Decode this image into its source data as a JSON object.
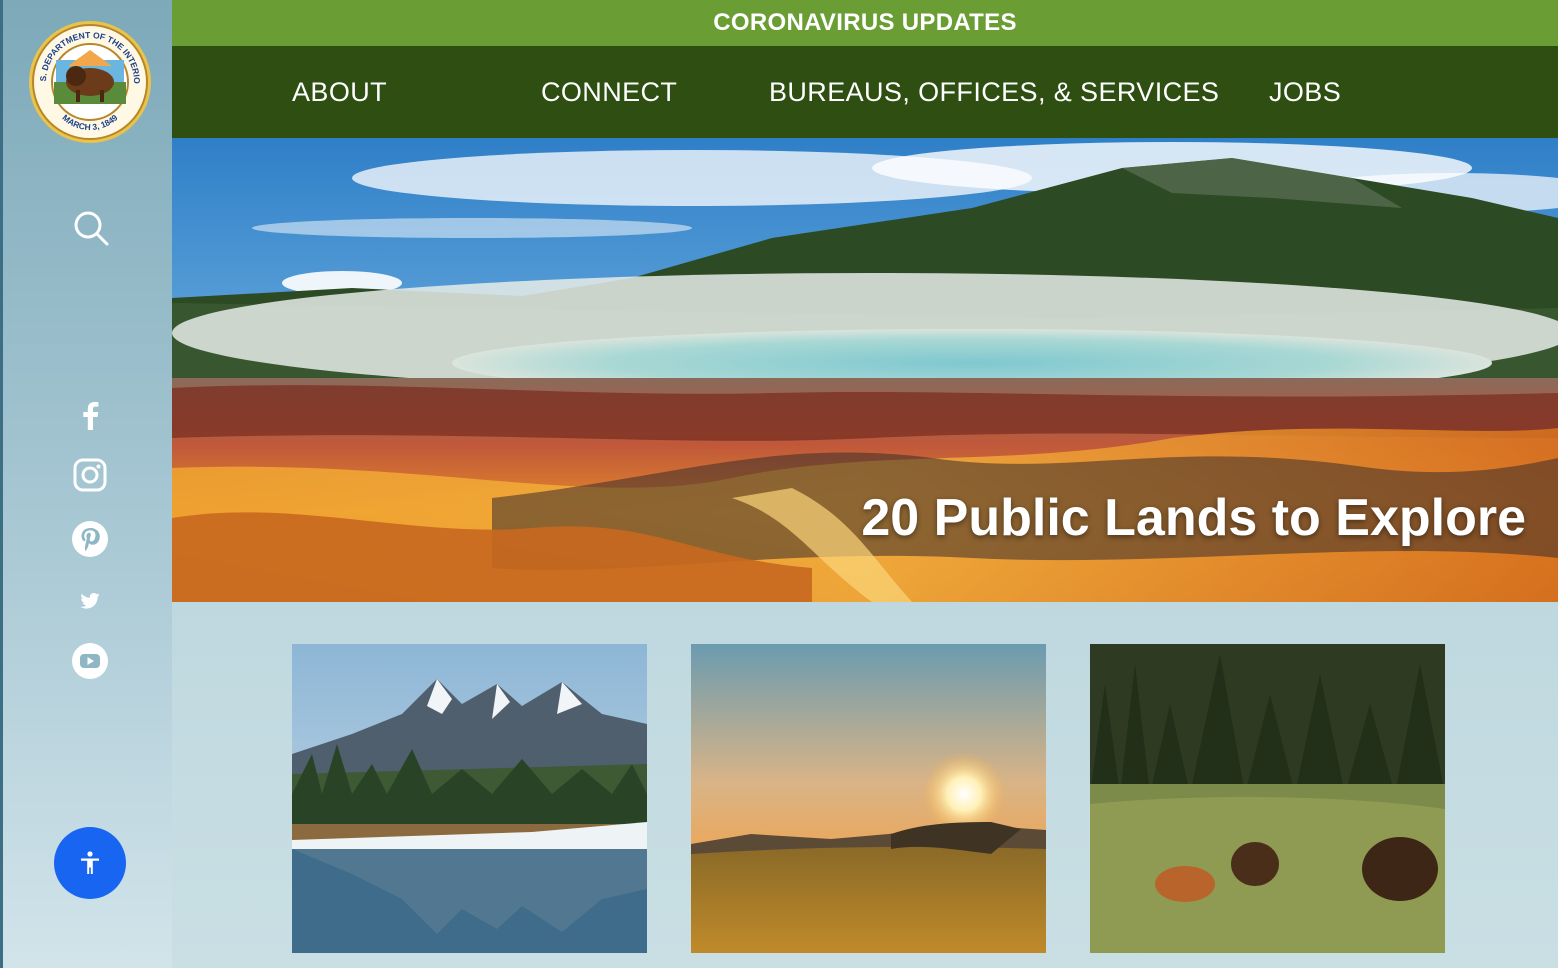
{
  "sidebar": {
    "seal": {
      "top_text": "U.S. DEPARTMENT OF THE INTERIOR",
      "bottom_text": "MARCH 3, 1849"
    },
    "search_icon": "search-icon",
    "social": [
      "facebook-icon",
      "instagram-icon",
      "pinterest-icon",
      "twitter-icon",
      "youtube-icon"
    ],
    "accessibility_icon": "accessibility-icon"
  },
  "banner": {
    "label": "CORONAVIRUS UPDATES"
  },
  "nav": {
    "items": [
      {
        "label": "ABOUT"
      },
      {
        "label": "CONNECT"
      },
      {
        "label": "BUREAUS, OFFICES, & SERVICES"
      },
      {
        "label": "JOBS"
      }
    ]
  },
  "hero": {
    "title": "20 Public Lands to Explore"
  },
  "cards": [
    {
      "image": "mountain-lake-photo"
    },
    {
      "image": "sunset-field-photo"
    },
    {
      "image": "bison-meadow-photo"
    }
  ],
  "colors": {
    "banner_green": "#6a9e34",
    "nav_green": "#2e4e12",
    "accessibility_blue": "#1865f2"
  }
}
